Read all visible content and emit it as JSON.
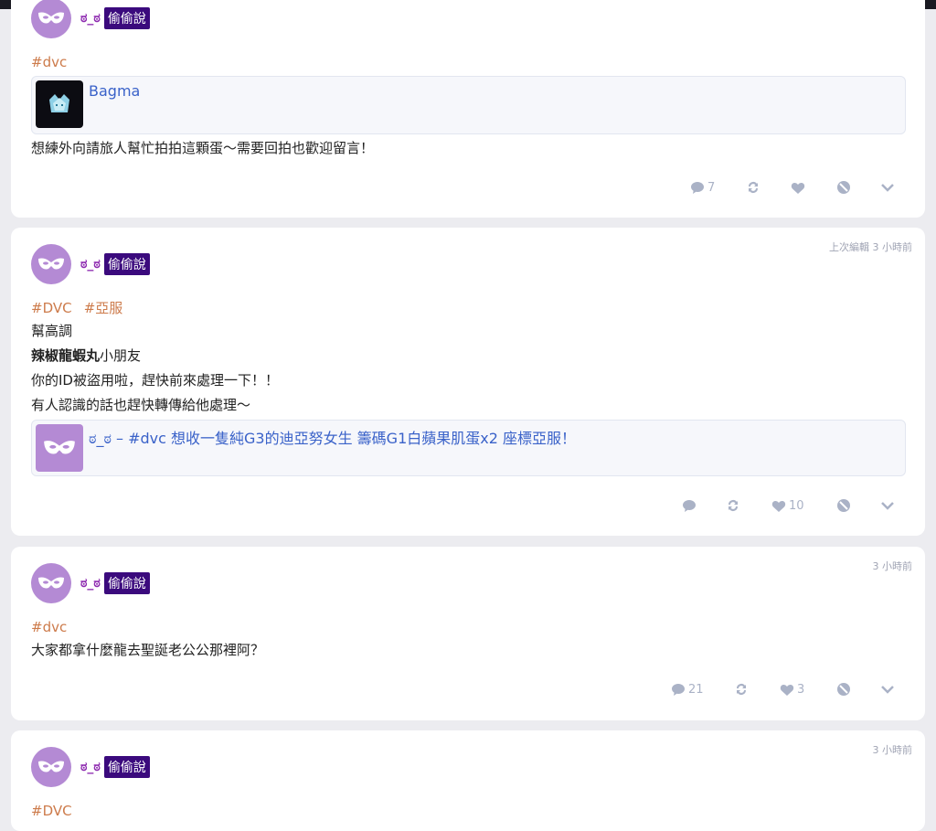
{
  "posts": [
    {
      "author": "ಠ_ಠ",
      "badge": "偷偷說",
      "timestamp": "",
      "tags": [
        "#dvc"
      ],
      "embed": {
        "title": "Bagma"
      },
      "lines": [
        "想練外向請旅人幫忙拍拍這顆蛋～需要回拍也歡迎留言！"
      ],
      "comments": "7",
      "likes": ""
    },
    {
      "author": "ಠ_ಠ",
      "badge": "偷偷說",
      "timestamp": "上次編輯 3 小時前",
      "tags": [
        "#DVC",
        "#亞服"
      ],
      "line1": "幫高調",
      "line2_bold": "辣椒龍蝦丸",
      "line2_rest": "小朋友",
      "line3": "你的ID被盜用啦，趕快前來處理一下！！",
      "line4": "有人認識的話也趕快轉傳給他處理～",
      "embed": {
        "title": "ಠ_ಠ – #dvc 想收一隻純G3的迪亞努女生 籌碼G1白蘋果肌蛋x2 座標亞服！"
      },
      "comments": "",
      "likes": "10"
    },
    {
      "author": "ಠ_ಠ",
      "badge": "偷偷說",
      "timestamp": "3 小時前",
      "tags": [
        "#dvc"
      ],
      "lines": [
        "大家都拿什麼龍去聖誕老公公那裡阿？"
      ],
      "comments": "21",
      "likes": "3"
    },
    {
      "author": "ಠ_ಠ",
      "badge": "偷偷說",
      "timestamp": "3 小時前",
      "tags": [
        "#DVC"
      ]
    }
  ],
  "icons": {
    "comment": "comment-icon",
    "repost": "repost-icon",
    "like": "heart-icon",
    "block": "block-icon",
    "more": "chevron-down-icon"
  },
  "colors": {
    "avatar": "#b48ad4",
    "author": "#8e2bb0",
    "badge": "#3b0a7d",
    "tag": "#cd7b4b",
    "link": "#3a62c9",
    "action": "#aab2c6"
  }
}
